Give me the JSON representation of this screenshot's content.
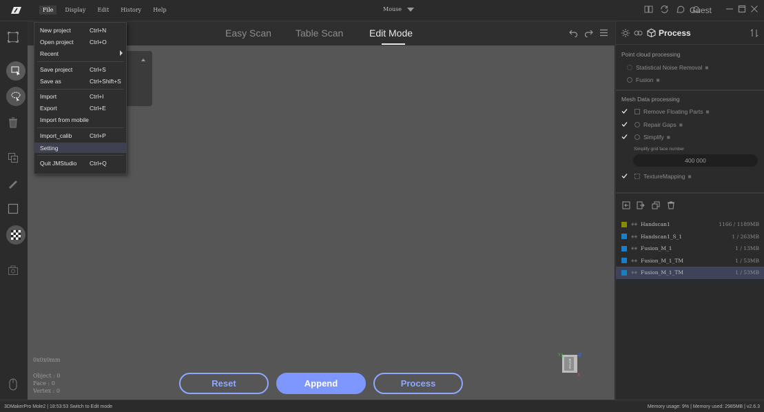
{
  "menubar": {
    "items": [
      "File",
      "Display",
      "Edit",
      "History",
      "Help"
    ],
    "active": "File"
  },
  "mode_select": {
    "value": "Mouse"
  },
  "user": {
    "name": "Guest"
  },
  "scan_modes": {
    "tabs": [
      "Easy Scan",
      "Table Scan",
      "Edit Mode"
    ],
    "active": "Edit Mode"
  },
  "file_menu": {
    "items": [
      {
        "label": "New project",
        "shortcut": "Ctrl+N"
      },
      {
        "label": "Open project",
        "shortcut": "Ctrl+O"
      },
      {
        "label": "Recent",
        "shortcut": ""
      },
      {
        "label": "Save project",
        "shortcut": "Ctrl+S"
      },
      {
        "label": "Save as",
        "shortcut": "Ctrl+Shift+S"
      },
      {
        "label": "Import",
        "shortcut": "Ctrl+I"
      },
      {
        "label": "Export",
        "shortcut": "Ctrl+E"
      },
      {
        "label": "Import from mobile",
        "shortcut": ""
      },
      {
        "label": "Import_calib",
        "shortcut": "Ctrl+P"
      },
      {
        "label": "Setting",
        "shortcut": ""
      },
      {
        "label": "Quit JMStudio",
        "shortcut": "Ctrl+Q"
      }
    ],
    "highlighted": "Setting"
  },
  "viewport": {
    "dimensions": "0x0x0mm",
    "object": "Object : 0",
    "face": "Face : 0",
    "vertex": "Vertex : 0",
    "cube_label": "BOTTOM"
  },
  "actions": {
    "reset": "Reset",
    "append": "Append",
    "process": "Process"
  },
  "process_panel": {
    "title": "Process",
    "point_cloud_section": "Point cloud processing",
    "point_cloud_items": [
      "Statistical Noise Removal",
      "Fusion"
    ],
    "mesh_section": "Mesh Data processing",
    "mesh_items": [
      {
        "label": "Remove Floating Parts",
        "checked": true
      },
      {
        "label": "Repair Gaps",
        "checked": true
      },
      {
        "label": "Simplify",
        "checked": true
      }
    ],
    "simplify_label": "Simplify grid face number",
    "simplify_value": "400 000",
    "texture_item": {
      "label": "TextureMapping",
      "checked": true
    }
  },
  "objects": [
    {
      "name": "Handscan1",
      "size": "1166 / 1189MB",
      "color": "#8a8a00",
      "selected": false
    },
    {
      "name": "Handscan1_S_1",
      "size": "1 / 263MB",
      "color": "#1a7fc2",
      "selected": false
    },
    {
      "name": "Fusion_M_1",
      "size": "1 / 13MB",
      "color": "#1a7fc2",
      "selected": false
    },
    {
      "name": "Fusion_M_1_TM",
      "size": "1 / 53MB",
      "color": "#1a7fc2",
      "selected": false
    },
    {
      "name": "Fusion_M_1_TM",
      "size": "1 / 53MB",
      "color": "#1a7fc2",
      "selected": true
    }
  ],
  "status": {
    "left": "3DMakerPro Mole2  |  18:53:53 Switch to Edit mode",
    "right": "Memory usage: 9% | Memory used: 2985MB | v2.6.3"
  },
  "colors": {
    "accent": "#7d97ff",
    "background": "#2b2b2b",
    "viewport": "#565656"
  }
}
